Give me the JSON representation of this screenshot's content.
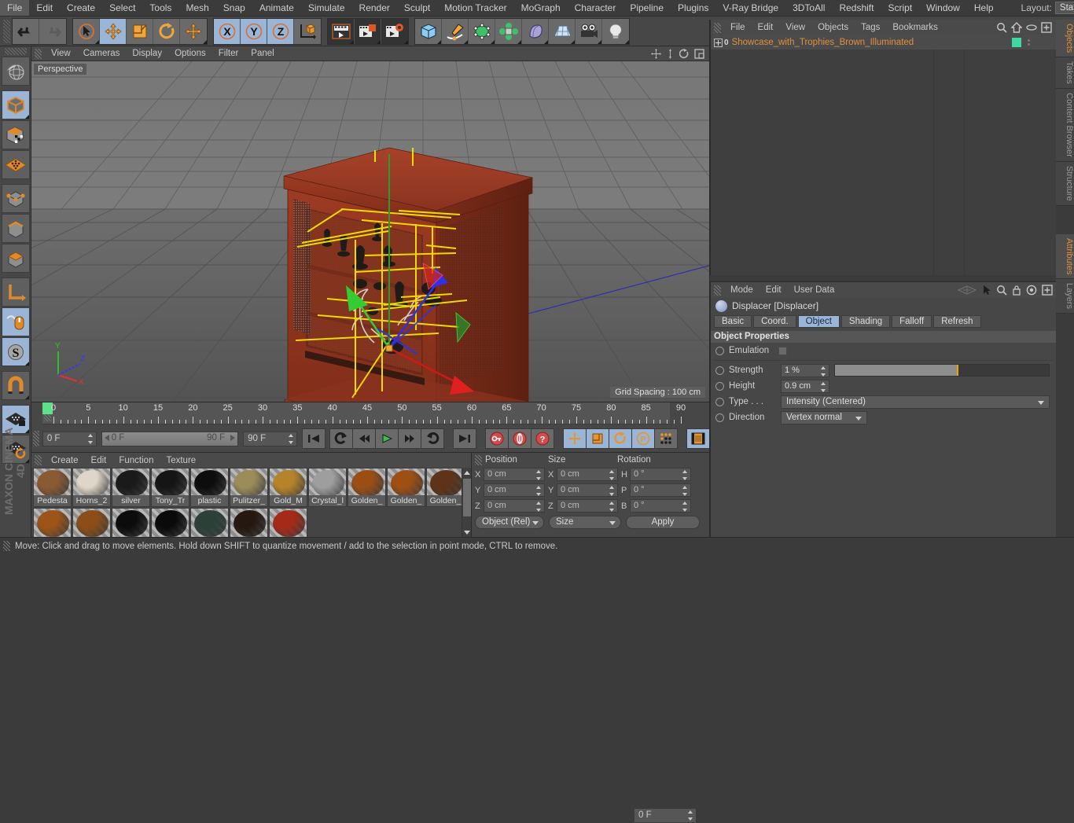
{
  "menubar": {
    "items": [
      "File",
      "Edit",
      "Create",
      "Select",
      "Tools",
      "Mesh",
      "Snap",
      "Animate",
      "Simulate",
      "Render",
      "Sculpt",
      "Motion Tracker",
      "MoGraph",
      "Character",
      "Pipeline",
      "Plugins",
      "V-Ray Bridge",
      "3DToAll",
      "Redshift",
      "Script",
      "Window",
      "Help"
    ],
    "layout_label": "Layout:",
    "layout_value": "Startup"
  },
  "toolbar": {
    "groups": [
      {
        "buttons": [
          {
            "name": "undo-button",
            "icon": "undo"
          },
          {
            "name": "redo-button",
            "icon": "redo"
          }
        ]
      },
      {
        "buttons": [
          {
            "name": "live-selection-tool",
            "icon": "cursor-circle"
          },
          {
            "name": "move-tool",
            "icon": "move"
          },
          {
            "name": "scale-tool",
            "icon": "scale"
          },
          {
            "name": "rotate-tool",
            "icon": "rotate"
          },
          {
            "name": "move-alt-tool",
            "icon": "move2"
          }
        ]
      },
      {
        "buttons": [
          {
            "name": "lock-x-axis",
            "icon": "X"
          },
          {
            "name": "lock-y-axis",
            "icon": "Y"
          },
          {
            "name": "lock-z-axis",
            "icon": "Z"
          },
          {
            "name": "world-object-coordinate",
            "icon": "axis-cube"
          }
        ]
      },
      {
        "buttons": [
          {
            "name": "render-view-button",
            "icon": "render-view"
          },
          {
            "name": "render-to-picture-viewer-button",
            "icon": "render-picture"
          },
          {
            "name": "edit-render-settings-button",
            "icon": "render-settings"
          }
        ]
      },
      {
        "buttons": [
          {
            "name": "add-cube-button",
            "icon": "cube"
          },
          {
            "name": "add-spline-button",
            "icon": "pen"
          },
          {
            "name": "add-generator-button",
            "icon": "generator"
          },
          {
            "name": "add-mograph-button",
            "icon": "mograph"
          },
          {
            "name": "add-deformer-button",
            "icon": "deformer"
          },
          {
            "name": "add-scene-button",
            "icon": "floor"
          },
          {
            "name": "add-camera-button",
            "icon": "camera"
          },
          {
            "name": "add-light-button",
            "icon": "light"
          }
        ]
      }
    ]
  },
  "lefttools": {
    "items": [
      {
        "name": "make-editable-button",
        "icon": "globe-mesh"
      },
      {
        "name": "model-mode-button",
        "icon": "cube-model",
        "selected": true
      },
      {
        "name": "texture-mode-button",
        "icon": "cube-texture"
      },
      {
        "name": "polygon-mode-button",
        "icon": "polygon-grid"
      },
      {
        "name": "point-mode-button",
        "icon": "cube-points"
      },
      {
        "name": "edge-mode-button",
        "icon": "cube-edge"
      },
      {
        "name": "polygon-face-mode-button",
        "icon": "cube-face"
      },
      {
        "name": "object-axis-button",
        "icon": "axis"
      },
      {
        "name": "enable-axis-button",
        "icon": "mouse-axis",
        "selected": true
      },
      {
        "name": "enable-snap-button",
        "icon": "snap-s",
        "selected": true
      },
      {
        "name": "magnet-tool-button",
        "icon": "magnet"
      },
      {
        "name": "workplane-lock-button",
        "icon": "plane-lock",
        "selected": true
      },
      {
        "name": "workplane-rotate-button",
        "icon": "plane-rotate"
      }
    ],
    "brand": "CINEMA 4D",
    "brand_top": "MAXON"
  },
  "viewport": {
    "menu": [
      "View",
      "Cameras",
      "Display",
      "Options",
      "Filter",
      "Panel"
    ],
    "label": "Perspective",
    "grid_spacing": "Grid Spacing : 100 cm",
    "axis": {
      "x": "X",
      "y": "Y",
      "z": "Z"
    }
  },
  "timeline": {
    "ticks": [
      "0",
      "5",
      "10",
      "15",
      "20",
      "25",
      "30",
      "35",
      "40",
      "45",
      "50",
      "55",
      "60",
      "65",
      "70",
      "75",
      "80",
      "85",
      "90"
    ],
    "current_frame": "0 F",
    "range_start": "0 F",
    "range_end": "90 F",
    "end_frame": "90 F",
    "right_frame": "0 F",
    "transport": [
      {
        "name": "goto-start-button",
        "icon": "skip-start"
      },
      {
        "name": "play-backwards-button",
        "icon": "loop-back"
      },
      {
        "name": "step-back-button",
        "icon": "prev-frame"
      },
      {
        "name": "play-button",
        "icon": "play"
      },
      {
        "name": "step-forward-button",
        "icon": "next-frame"
      },
      {
        "name": "play-forwards-button",
        "icon": "loop-fwd"
      },
      {
        "name": "goto-end-button",
        "icon": "skip-end"
      }
    ],
    "keyframe_buttons": [
      {
        "name": "record-active-objects-button",
        "icon": "key"
      },
      {
        "name": "autokeying-button",
        "icon": "auto-key"
      },
      {
        "name": "keyframe-selection-button",
        "icon": "question-key"
      }
    ],
    "param_buttons": [
      {
        "name": "position-key-button",
        "icon": "move"
      },
      {
        "name": "scale-key-button",
        "icon": "scale"
      },
      {
        "name": "rotation-key-button",
        "icon": "rotate"
      },
      {
        "name": "pla-key-button",
        "icon": "P"
      },
      {
        "name": "point-level-anim-button",
        "icon": "dots"
      },
      {
        "name": "timeline-button",
        "icon": "filmstrip"
      }
    ]
  },
  "materials": {
    "menu": [
      "Create",
      "Edit",
      "Function",
      "Texture"
    ],
    "row1": [
      {
        "label": "Pedesta",
        "color": "#8a5a33"
      },
      {
        "label": "Horns_2",
        "color": "#ded6c8"
      },
      {
        "label": "silver",
        "color": "#1a1a1a"
      },
      {
        "label": "Tony_Tr",
        "color": "#151515"
      },
      {
        "label": "plastic",
        "color": "#0d0d0d"
      },
      {
        "label": "Pulitzer_",
        "color": "#9b8c5a"
      },
      {
        "label": "Gold_M",
        "color": "#b5842a"
      },
      {
        "label": "Crystal_l",
        "color": "#9e9e9e"
      },
      {
        "label": "Golden_",
        "color": "#9a4e14"
      },
      {
        "label": "Golden_",
        "color": "#9e4f13"
      },
      {
        "label": "Golden_",
        "color": "#5e3317"
      }
    ],
    "row2": [
      {
        "label": "",
        "color": "#9c5418"
      },
      {
        "label": "",
        "color": "#8c4d18"
      },
      {
        "label": "",
        "color": "#0c0c0c"
      },
      {
        "label": "",
        "color": "#0a0a0a"
      },
      {
        "label": "",
        "color": "#2b4138"
      },
      {
        "label": "",
        "color": "#241810"
      },
      {
        "label": "",
        "color": "#a62a18"
      }
    ]
  },
  "coordinates": {
    "headers": {
      "position": "Position",
      "size": "Size",
      "rotation": "Rotation"
    },
    "rows": [
      {
        "pos_axis": "X",
        "pos_value": "0 cm",
        "size_axis": "X",
        "size_value": "0 cm",
        "rot_axis": "H",
        "rot_value": "0 °"
      },
      {
        "pos_axis": "Y",
        "pos_value": "0 cm",
        "size_axis": "Y",
        "size_value": "0 cm",
        "rot_axis": "P",
        "rot_value": "0 °"
      },
      {
        "pos_axis": "Z",
        "pos_value": "0 cm",
        "size_axis": "Z",
        "size_value": "0 cm",
        "rot_axis": "B",
        "rot_value": "0 °"
      }
    ],
    "mode_select": "Object (Rel)",
    "size_select": "Size",
    "apply_label": "Apply"
  },
  "object_manager": {
    "menu": [
      "File",
      "Edit",
      "View",
      "Objects",
      "Tags",
      "Bookmarks"
    ],
    "icons": [
      "search-icon",
      "home-icon",
      "eye-icon",
      "add-icon"
    ],
    "rows": [
      {
        "level": "0",
        "name": "Showcase_with_Trophies_Brown_Illuminated",
        "tag_color": "#3fd9a0"
      }
    ]
  },
  "attribute_manager": {
    "menu": [
      "Mode",
      "Edit",
      "User Data"
    ],
    "icons": [
      "plane-icon",
      "cursor-icon",
      "search-icon",
      "lock-icon",
      "target-icon",
      "add-icon"
    ],
    "title": "Displacer [Displacer]",
    "tabs": [
      {
        "label": "Basic",
        "active": false
      },
      {
        "label": "Coord.",
        "active": false
      },
      {
        "label": "Object",
        "active": true
      },
      {
        "label": "Shading",
        "active": false
      },
      {
        "label": "Falloff",
        "active": false
      },
      {
        "label": "Refresh",
        "active": false
      }
    ],
    "section": "Object Properties",
    "props": {
      "emulation_label": "Emulation",
      "strength_label": "Strength",
      "strength_value": "1 %",
      "strength_pct": 57,
      "height_label": "Height",
      "height_value": "0.9 cm",
      "type_label": "Type . . .",
      "type_value": "Intensity (Centered)",
      "direction_label": "Direction",
      "direction_value": "Vertex normal"
    }
  },
  "vtabs_right": [
    {
      "label": "Objects",
      "active": true
    },
    {
      "label": "Takes",
      "active": false
    },
    {
      "label": "Content Browser",
      "active": false
    },
    {
      "label": "Structure",
      "active": false
    }
  ],
  "vtabs_right_lower": [
    {
      "label": "Attributes",
      "active": true
    },
    {
      "label": "Layers",
      "active": false
    }
  ],
  "statusbar": {
    "text": "Move: Click and drag to move elements. Hold down SHIFT to quantize movement / add to the selection in point mode, CTRL to remove."
  },
  "colors": {
    "accent_orange": "#e0903c",
    "selected_blue": "#9bb5d6",
    "tag_green": "#3fd9a0",
    "slider_knob": "#f0a000"
  }
}
